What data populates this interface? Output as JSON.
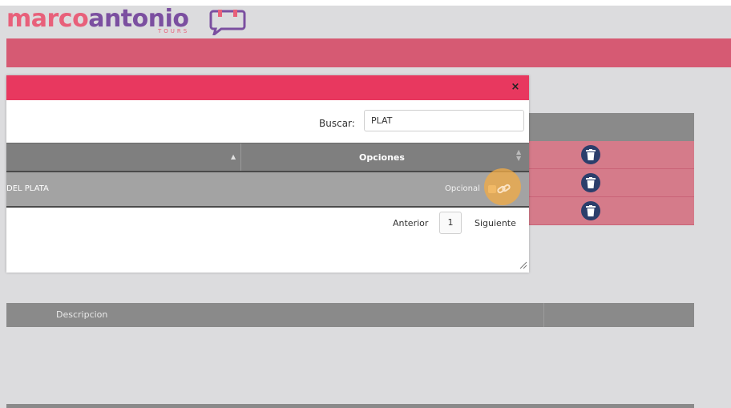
{
  "brand": {
    "word_part1": "marco",
    "word_part2": "antonio",
    "tagline": "TOURS",
    "colors": {
      "pink": "#e8607a",
      "purple": "#7b4fa0"
    }
  },
  "colors": {
    "header_bar": "#d65a73",
    "modal_title_bar": "#e8385f",
    "table_header": "#7f7f7f",
    "row_pink": "#d57b8a",
    "trash_icon": "#2c3e6b"
  },
  "modal": {
    "close_label": "×",
    "search_label": "Buscar:",
    "search_value": "PLAT",
    "columns": {
      "name_sort_icon": "sort-asc-icon",
      "options": "Opciones",
      "options_sort_icon": "sort-both-icon"
    },
    "rows": [
      {
        "name": "DEL PLATA",
        "option": "Opcional"
      }
    ],
    "pagination": {
      "previous": "Anterior",
      "page": "1",
      "next": "Siguiente"
    }
  },
  "background_table": {
    "rows": [
      {
        "icon": "trash-icon"
      },
      {
        "icon": "trash-icon"
      },
      {
        "icon": "trash-icon"
      }
    ]
  },
  "lower_table": {
    "header": "Descripcion"
  }
}
